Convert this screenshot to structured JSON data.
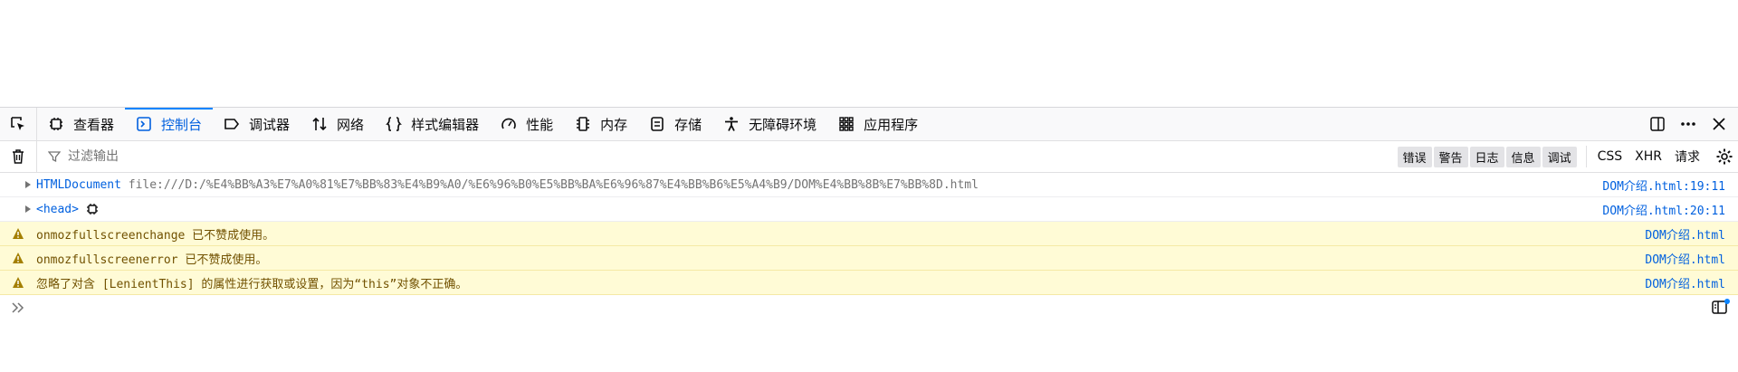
{
  "toolbar": {
    "tabs": [
      {
        "label": "查看器",
        "icon": "inspector-icon"
      },
      {
        "label": "控制台",
        "icon": "console-icon",
        "active": true
      },
      {
        "label": "调试器",
        "icon": "debugger-icon"
      },
      {
        "label": "网络",
        "icon": "network-icon"
      },
      {
        "label": "样式编辑器",
        "icon": "style-editor-icon"
      },
      {
        "label": "性能",
        "icon": "performance-icon"
      },
      {
        "label": "内存",
        "icon": "memory-icon"
      },
      {
        "label": "存储",
        "icon": "storage-icon"
      },
      {
        "label": "无障碍环境",
        "icon": "accessibility-icon"
      },
      {
        "label": "应用程序",
        "icon": "application-icon"
      }
    ]
  },
  "filterbar": {
    "placeholder": "过滤输出",
    "levels": [
      "错误",
      "警告",
      "日志",
      "信息",
      "调试"
    ],
    "css": "CSS",
    "xhr": "XHR",
    "requests": "请求"
  },
  "messages": [
    {
      "type": "log",
      "object": "HTMLDocument",
      "text": "file:///D:/%E4%BB%A3%E7%A0%81%E7%BB%83%E4%B9%A0/%E6%96%B0%E5%BB%BA%E6%96%87%E4%BB%B6%E5%A4%B9/DOM%E4%BB%8B%E7%BB%8D.html",
      "location": "DOM介绍.html:19:11"
    },
    {
      "type": "log",
      "object": "<head>",
      "location": "DOM介绍.html:20:11"
    },
    {
      "type": "warn",
      "text": "onmozfullscreenchange 已不赞成使用。",
      "location": "DOM介绍.html"
    },
    {
      "type": "warn",
      "text": "onmozfullscreenerror 已不赞成使用。",
      "location": "DOM介绍.html"
    },
    {
      "type": "warn",
      "text": "忽略了对含 [LenientThis] 的属性进行获取或设置，因为“this”对象不正确。",
      "location": "DOM介绍.html"
    }
  ],
  "colors": {
    "accent": "#0060df",
    "warn_bg": "#fffbd6",
    "warn_text": "#715100"
  }
}
